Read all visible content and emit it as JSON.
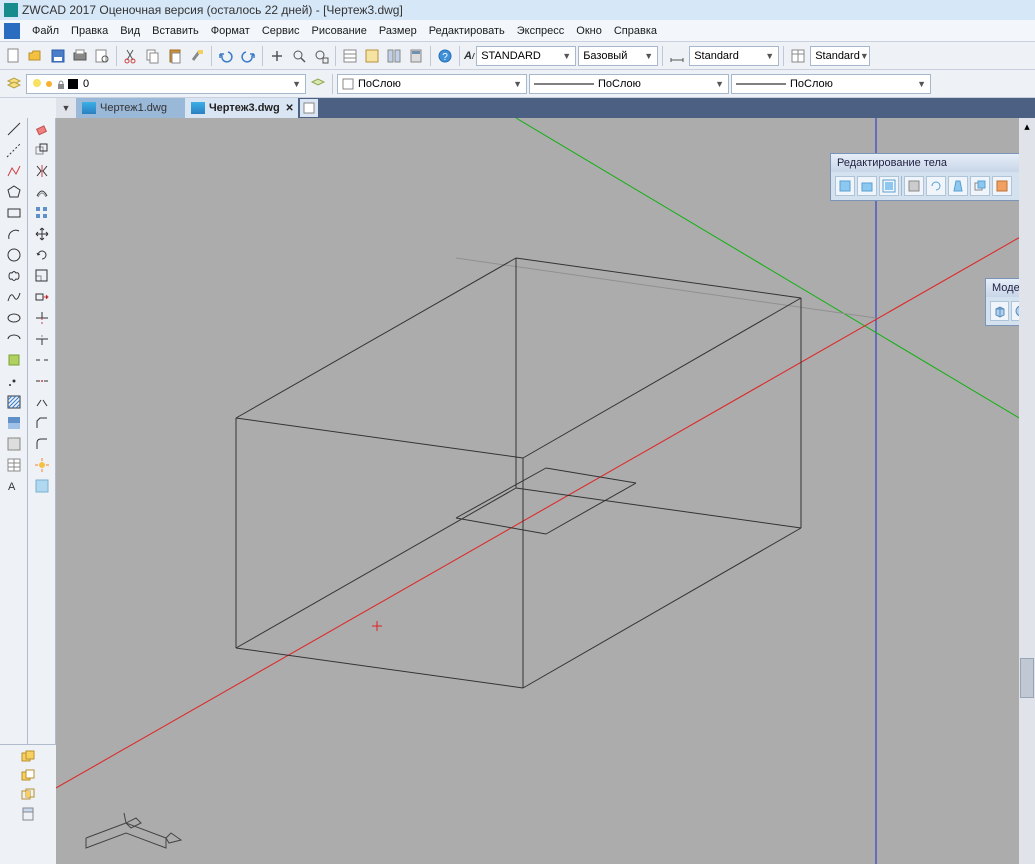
{
  "title": "ZWCAD 2017 Оценочная версия (осталось 22 дней) - [Чертеж3.dwg]",
  "menu": [
    "Файл",
    "Правка",
    "Вид",
    "Вставить",
    "Формат",
    "Сервис",
    "Рисование",
    "Размер",
    "Редактировать",
    "Экспресс",
    "Окно",
    "Справка"
  ],
  "toolbar1": {
    "style_dd": "STANDARD",
    "view_dd": "Базовый",
    "dim_dd": "Standard",
    "tbl_dd": "Standard"
  },
  "toolbar2": {
    "layer_value": "0",
    "linetype1": "ПоСлою",
    "linetype2": "ПоСлою",
    "linetype3": "ПоСлою"
  },
  "tabs": {
    "inactive": "Чертеж1.dwg",
    "active": "Чертеж3.dwg"
  },
  "panels": {
    "edit_body": "Редактирование тела",
    "modeling": "Модели"
  }
}
